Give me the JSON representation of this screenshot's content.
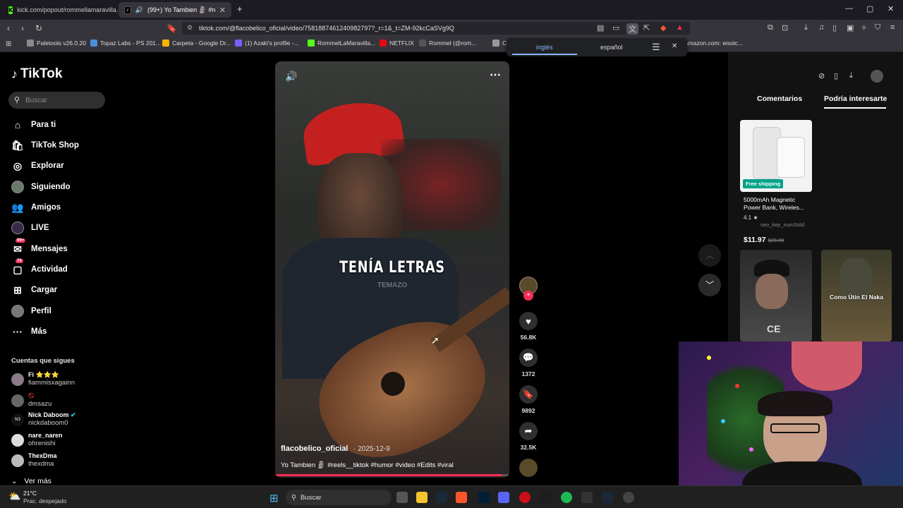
{
  "browser": {
    "tabs": [
      {
        "label": "kick.com/popout/rommellamaravilla..."
      },
      {
        "label": "(99+) Yo Tambien 🗿 #reels_..."
      }
    ],
    "new_tab": "+",
    "window_controls": {
      "minimize": "—",
      "maximize": "▢",
      "close": "✕"
    },
    "url": "tiktok.com/@flacobelico_oficial/video/7581887461240982797?_r=1&_t=ZM-92kcCaSVg9Q",
    "bookmarks": [
      {
        "label": "Paletools v26.0.20",
        "color": "#8a8a8a"
      },
      {
        "label": "Topaz Labs - PS 201...",
        "color": "#4a90d9"
      },
      {
        "label": "Carpeta - Google Dr...",
        "color": "#f4b400"
      },
      {
        "label": "(1) Azaki's profile -...",
        "color": "#7c5cff"
      },
      {
        "label": "RommelLaMaravilla...",
        "color": "#53fc18"
      },
      {
        "label": "NETFLIX",
        "color": "#e50914"
      },
      {
        "label": "Rommel (@rom...",
        "color": "#555555"
      },
      {
        "label": "C",
        "color": "#999999"
      },
      {
        "label": "Amazon.com: eisoic...",
        "color": "#ff9900"
      }
    ],
    "translate": {
      "from": "inglés",
      "to": "español"
    }
  },
  "tiktok": {
    "logo": "TikTok",
    "search_placeholder": "Buscar",
    "nav": [
      {
        "label": "Para ti",
        "icon": "home-icon"
      },
      {
        "label": "TikTok Shop",
        "icon": "shop-icon"
      },
      {
        "label": "Explorar",
        "icon": "compass-icon"
      },
      {
        "label": "Siguiendo",
        "icon": "avatar"
      },
      {
        "label": "Amigos",
        "icon": "friends-icon"
      },
      {
        "label": "LIVE",
        "icon": "live-icon"
      },
      {
        "label": "Mensajes",
        "icon": "messages-icon",
        "badge": "99+"
      },
      {
        "label": "Actividad",
        "icon": "activity-icon",
        "badge": "79"
      },
      {
        "label": "Cargar",
        "icon": "upload-icon"
      },
      {
        "label": "Perfil",
        "icon": "avatar"
      },
      {
        "label": "Más",
        "icon": "more-icon"
      }
    ],
    "following_title": "Cuentas que sigues",
    "accounts": [
      {
        "name": "Fi ⭐⭐⭐",
        "user": "fiammisxagainn"
      },
      {
        "name": "🚫",
        "user": "dmsazu"
      },
      {
        "name": "Nick Daboom",
        "user": "nickdaboom0",
        "verified": true
      },
      {
        "name": "nare_naren",
        "user": "ohrenishi"
      },
      {
        "name": "ThexDma",
        "user": "thexdma"
      }
    ],
    "see_more": "Ver más",
    "video": {
      "overlay_title": "TENÍA LETRAS",
      "overlay_sub": "TEMAZO",
      "author": "flacobelico_oficial",
      "date": "· 2025-12-9",
      "description": "Yo Tambien 🗿 #reels__tiktok #humor #video #Edits #viral",
      "progress": 0.97
    },
    "actions": {
      "likes": "56.8K",
      "comments": "1372",
      "saves": "9892",
      "shares": "32.5K"
    },
    "right_tabs": {
      "comments": "Comentarios",
      "interesting": "Podría interesarte"
    },
    "product": {
      "badge": "Free shipping",
      "title": "5000mAh Magnetic Power Bank, Wireles...",
      "rating": "4.1 ★",
      "sold": "seo_kep_numSold",
      "price": "$11.97",
      "old_price": "$28.80"
    },
    "thumb2_text": "Como Ütin El Naka"
  },
  "taskbar": {
    "weather_temp": "21°C",
    "weather_desc": "Prac. despejado",
    "search": "Buscar"
  }
}
